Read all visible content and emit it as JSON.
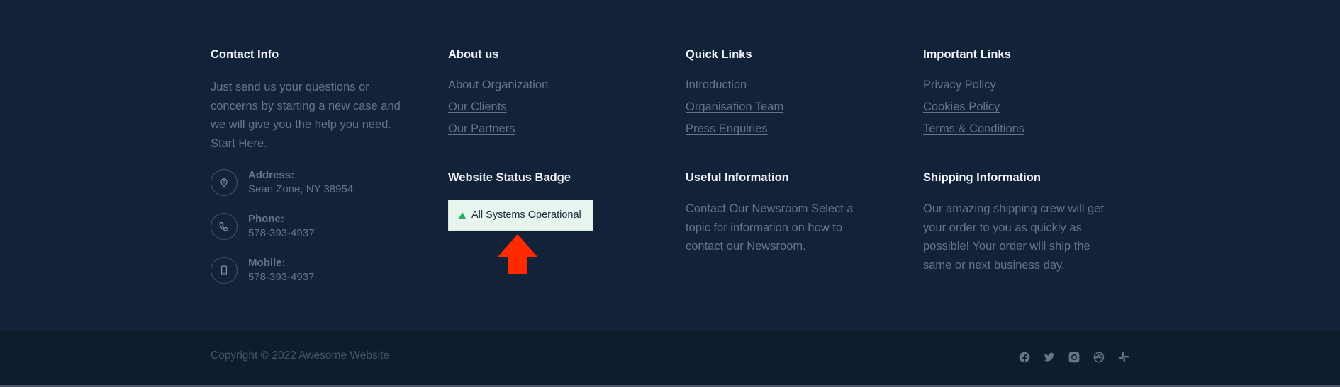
{
  "contact": {
    "heading": "Contact Info",
    "description": "Just send us your questions or concerns by starting a new case and we will give you the help you need. Start Here.",
    "items": [
      {
        "icon": "map-pin-icon",
        "label": "Address:",
        "value": "Sean Zone, NY 38954"
      },
      {
        "icon": "phone-icon",
        "label": "Phone:",
        "value": "578-393-4937"
      },
      {
        "icon": "mobile-icon",
        "label": "Mobile:",
        "value": "578-393-4937"
      }
    ]
  },
  "about": {
    "heading": "About us",
    "links": [
      "About Organization",
      "Our Clients",
      "Our Partners"
    ]
  },
  "status": {
    "heading": "Website Status Badge",
    "badge_text": "All Systems Operational",
    "badge_color": "#27ae60",
    "annotation": "red-up-arrow"
  },
  "quick_links": {
    "heading": "Quick Links",
    "links": [
      "Introduction",
      "Organisation Team",
      "Press Enquiries"
    ]
  },
  "useful_info": {
    "heading": "Useful Information",
    "text": "Contact Our Newsroom Select a topic for information on how to contact our Newsroom."
  },
  "important_links": {
    "heading": "Important Links",
    "links": [
      "Privacy Policy",
      "Cookies Policy",
      "Terms & Conditions"
    ]
  },
  "shipping_info": {
    "heading": "Shipping Information",
    "text": "Our amazing shipping crew will get your order to you as quickly as possible! Your order will ship the same or next business day."
  },
  "bottom": {
    "copyright": "Copyright © 2022 Awesome Website",
    "social": [
      "facebook-icon",
      "twitter-icon",
      "instagram-icon",
      "dribbble-icon",
      "slack-icon"
    ]
  }
}
